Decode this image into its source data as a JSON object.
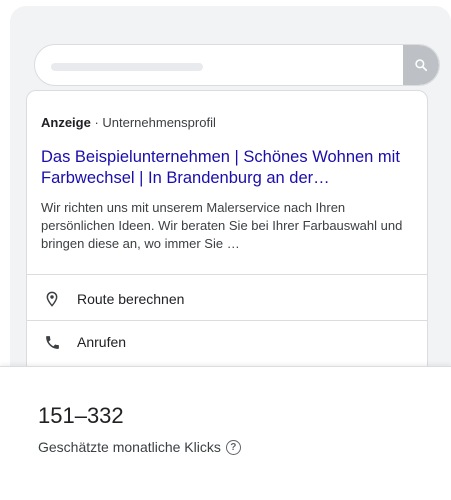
{
  "ad": {
    "label_bold": "Anzeige",
    "label_rest": " · Unternehmensprofil",
    "title": "Das Beispielunternehmen | Schönes Wohnen mit Farbwechsel | In Brandenburg an der…",
    "description": "Wir richten uns mit unserem Malerservice nach Ihren persönlichen Ideen. Wir beraten Sie bei Ihrer Farbauswahl und bringen diese an, wo immer Sie …",
    "actions": [
      {
        "label": "Route berechnen",
        "icon": "location-pin-icon"
      },
      {
        "label": "Anrufen",
        "icon": "phone-icon"
      }
    ]
  },
  "search": {
    "icon": "search-icon"
  },
  "stats": {
    "range": "151–332",
    "label": "Geschätzte monatliche Klicks",
    "help_icon": "help-icon",
    "help_glyph": "?"
  },
  "colors": {
    "link": "#1a0dab",
    "text": "#202124",
    "muted": "#3c4043"
  }
}
